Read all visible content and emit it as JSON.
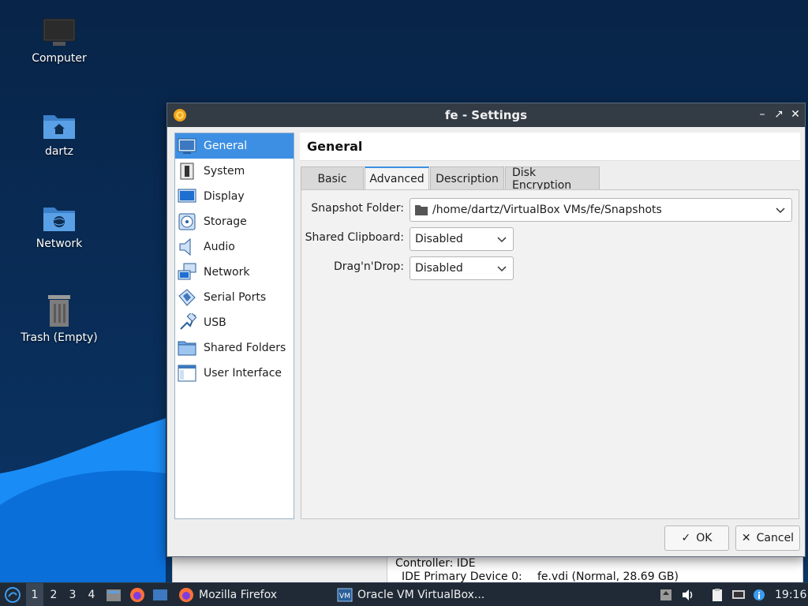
{
  "desktop": {
    "icons": [
      {
        "label": "Computer"
      },
      {
        "label": "dartz"
      },
      {
        "label": "Network"
      },
      {
        "label": "Trash (Empty)"
      }
    ]
  },
  "background_window": {
    "line1": "Controller: IDE",
    "line2_label": "IDE Primary Device 0:",
    "line2_value": "fe.vdi (Normal, 28.69 GB)"
  },
  "dialog": {
    "title": "fe - Settings",
    "sidebar": {
      "items": [
        {
          "label": "General",
          "icon": "general-icon"
        },
        {
          "label": "System",
          "icon": "system-icon"
        },
        {
          "label": "Display",
          "icon": "display-icon"
        },
        {
          "label": "Storage",
          "icon": "storage-icon"
        },
        {
          "label": "Audio",
          "icon": "audio-icon"
        },
        {
          "label": "Network",
          "icon": "network-icon"
        },
        {
          "label": "Serial Ports",
          "icon": "serial-ports-icon"
        },
        {
          "label": "USB",
          "icon": "usb-icon"
        },
        {
          "label": "Shared Folders",
          "icon": "shared-folders-icon"
        },
        {
          "label": "User Interface",
          "icon": "user-interface-icon"
        }
      ],
      "selected": "General"
    },
    "section_title": "General",
    "tabs": [
      {
        "label": "Basic"
      },
      {
        "label": "Advanced"
      },
      {
        "label": "Description"
      },
      {
        "label": "Disk Encryption"
      }
    ],
    "active_tab": "Advanced",
    "fields": {
      "snapshot_folder": {
        "label": "Snapshot Folder:",
        "value": "/home/dartz/VirtualBox VMs/fe/Snapshots"
      },
      "shared_clipboard": {
        "label": "Shared Clipboard:",
        "value": "Disabled"
      },
      "drag_n_drop": {
        "label": "Drag'n'Drop:",
        "value": "Disabled"
      }
    },
    "buttons": {
      "ok": "OK",
      "cancel": "Cancel"
    }
  },
  "taskbar": {
    "workspaces": [
      "1",
      "2",
      "3",
      "4"
    ],
    "active_workspace": "1",
    "tasks": [
      {
        "label": "Mozilla Firefox"
      },
      {
        "label": "Oracle VM VirtualBox..."
      }
    ],
    "clock": "19:16"
  },
  "colors": {
    "accent": "#3d8fe3",
    "titlebar": "#333b44",
    "taskbar": "#1f2a36",
    "desktop": "#0b2a52"
  }
}
